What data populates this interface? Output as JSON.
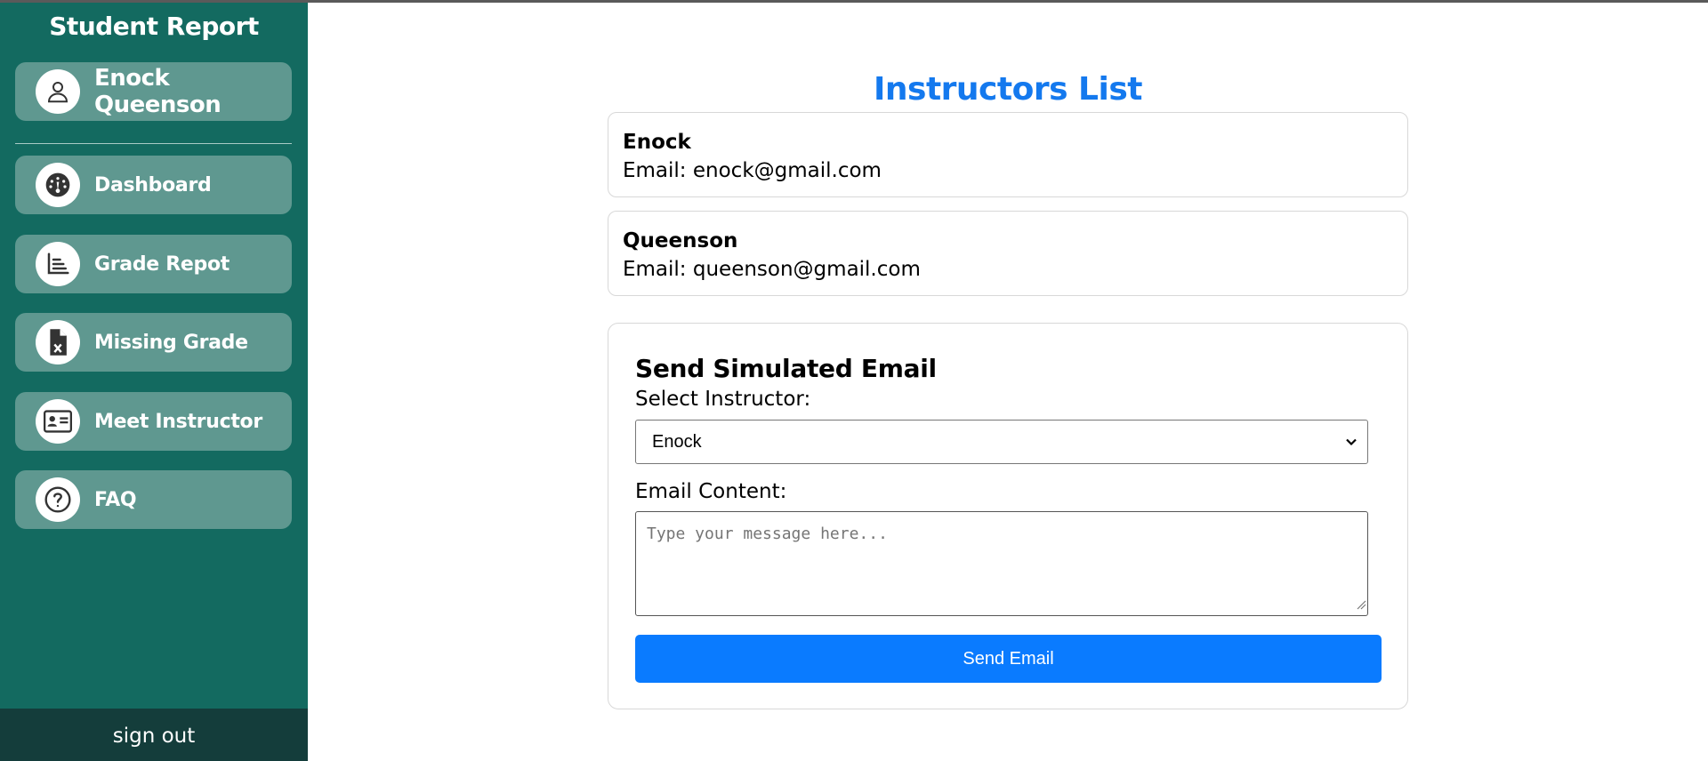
{
  "sidebar": {
    "title": "Student Report",
    "profile": {
      "name": "Enock Queenson",
      "icon": "user-icon"
    },
    "items": [
      {
        "label": "Dashboard",
        "icon": "gauge-icon"
      },
      {
        "label": "Grade Repot",
        "icon": "chart-bars-icon"
      },
      {
        "label": "Missing Grade",
        "icon": "file-x-icon"
      },
      {
        "label": "Meet Instructor",
        "icon": "id-card-icon"
      },
      {
        "label": "FAQ",
        "icon": "question-icon"
      }
    ],
    "signout": "sign out"
  },
  "main": {
    "title": "Instructors List",
    "instructors": [
      {
        "name": "Enock",
        "email": "Email: enock@gmail.com"
      },
      {
        "name": "Queenson",
        "email": "Email: queenson@gmail.com"
      }
    ],
    "form": {
      "title": "Send Simulated Email",
      "select_label": "Select Instructor:",
      "selected": "Enock",
      "content_label": "Email Content:",
      "placeholder": "Type your message here...",
      "button": "Send Email"
    }
  },
  "colors": {
    "sidebar_bg": "#136a60",
    "nav_item_bg": "#5f9890",
    "signout_bg": "#143d3b",
    "accent": "#1479ee",
    "button": "#0a7bff"
  }
}
